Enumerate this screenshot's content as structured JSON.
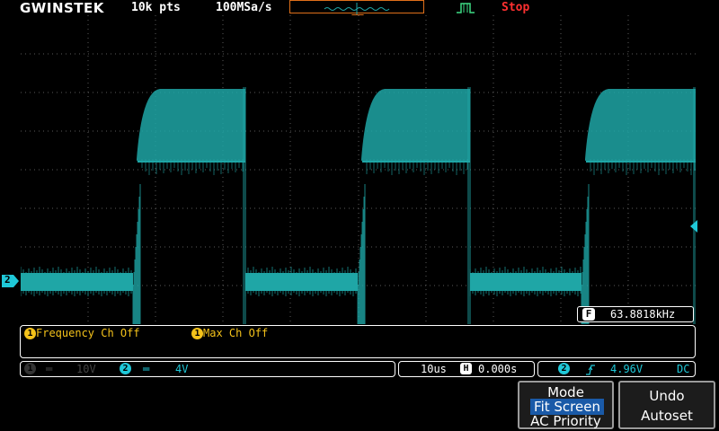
{
  "header": {
    "logo": "GWINSTEK",
    "record_length": "10k pts",
    "sample_rate": "100MSa/s",
    "run_status": "Stop"
  },
  "measurement": {
    "badge": "F",
    "frequency": "63.8818kHz"
  },
  "info_panel": {
    "meas1_num": "1",
    "meas1_text": "Frequency Ch Off",
    "meas2_num": "1",
    "meas2_text": "Max Ch Off"
  },
  "status_bar": {
    "ch1_num": "1",
    "ch1_coupling": "═",
    "ch1_scale": "10V",
    "ch2_num": "2",
    "ch2_coupling": "═",
    "ch2_scale": "4V",
    "timebase": "10us",
    "h_badge": "H",
    "h_position": "0.000s",
    "trig_source": "2",
    "trig_level": "4.96V",
    "trig_coupling": "DC"
  },
  "softkeys": {
    "mode_title": "Mode",
    "mode_option_selected": "Fit Screen",
    "mode_option_other": "AC Priority",
    "undo_line1": "Undo",
    "undo_line2": "Autoset"
  },
  "ch2_marker_label": "2",
  "colors": {
    "trace": "#1fa6a6",
    "accent_orange": "#e0701a",
    "measurement_yellow": "#f4c21a",
    "ch2_cyan": "#1fc8d8",
    "stop_red": "#ff3030",
    "softkey_selected": "#1a5aa8"
  }
}
